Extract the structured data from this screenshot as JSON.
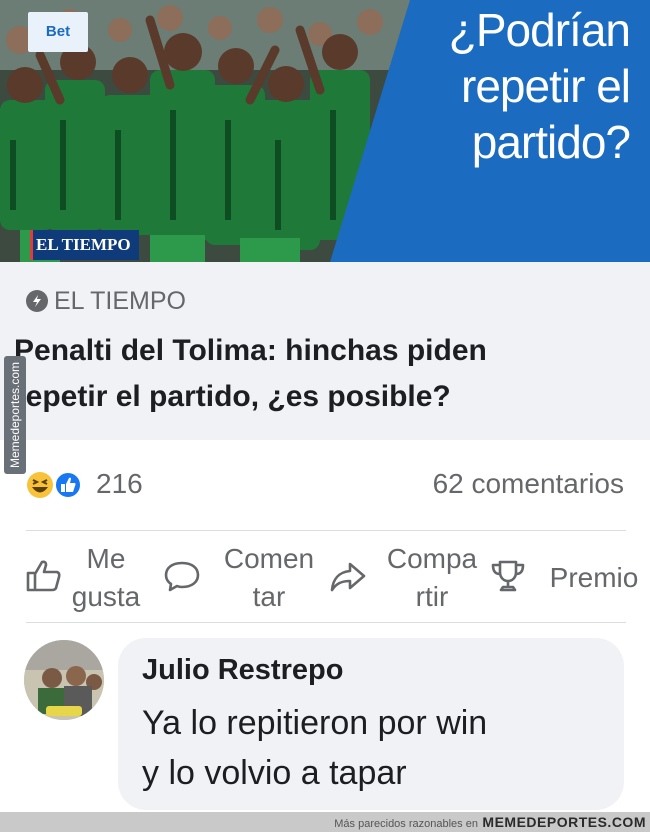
{
  "hero": {
    "headline_lines": [
      "¿Podrían",
      "repetir el",
      "partido?"
    ],
    "source_badge": "EL TIEMPO",
    "sponsor_text": "Bet"
  },
  "card": {
    "source": "EL TIEMPO",
    "title_line1": "Penalti del Tolima: hinchas piden",
    "title_line2": "repetir el partido, ¿es posible?"
  },
  "side_watermark": "Memedeportes.com",
  "reactions": {
    "count": "216",
    "comments": "62 comentarios",
    "icons": [
      "haha-icon",
      "like-icon"
    ]
  },
  "actions": [
    {
      "name": "like",
      "lines": [
        "Me",
        "gusta"
      ],
      "icon": "thumbs-up-icon"
    },
    {
      "name": "comment",
      "lines": [
        "Comen",
        "tar"
      ],
      "icon": "speech-bubble-icon"
    },
    {
      "name": "share",
      "lines": [
        "Compa",
        "rtir"
      ],
      "icon": "share-arrow-icon"
    },
    {
      "name": "award",
      "lines": [
        "Premio"
      ],
      "icon": "trophy-icon"
    }
  ],
  "comment": {
    "author": "Julio Restrepo",
    "line1": "Ya lo repitieron por win",
    "line2": "y lo volvio a tapar"
  },
  "footer": {
    "tagline": "Más parecidos razonables en",
    "brand": "MEMEDEPORTES.COM"
  },
  "colors": {
    "accent_blue": "#1b6bc0",
    "team_green": "#1f7a3a",
    "text_gray": "#65676b",
    "card_bg": "#f0f2f5"
  }
}
